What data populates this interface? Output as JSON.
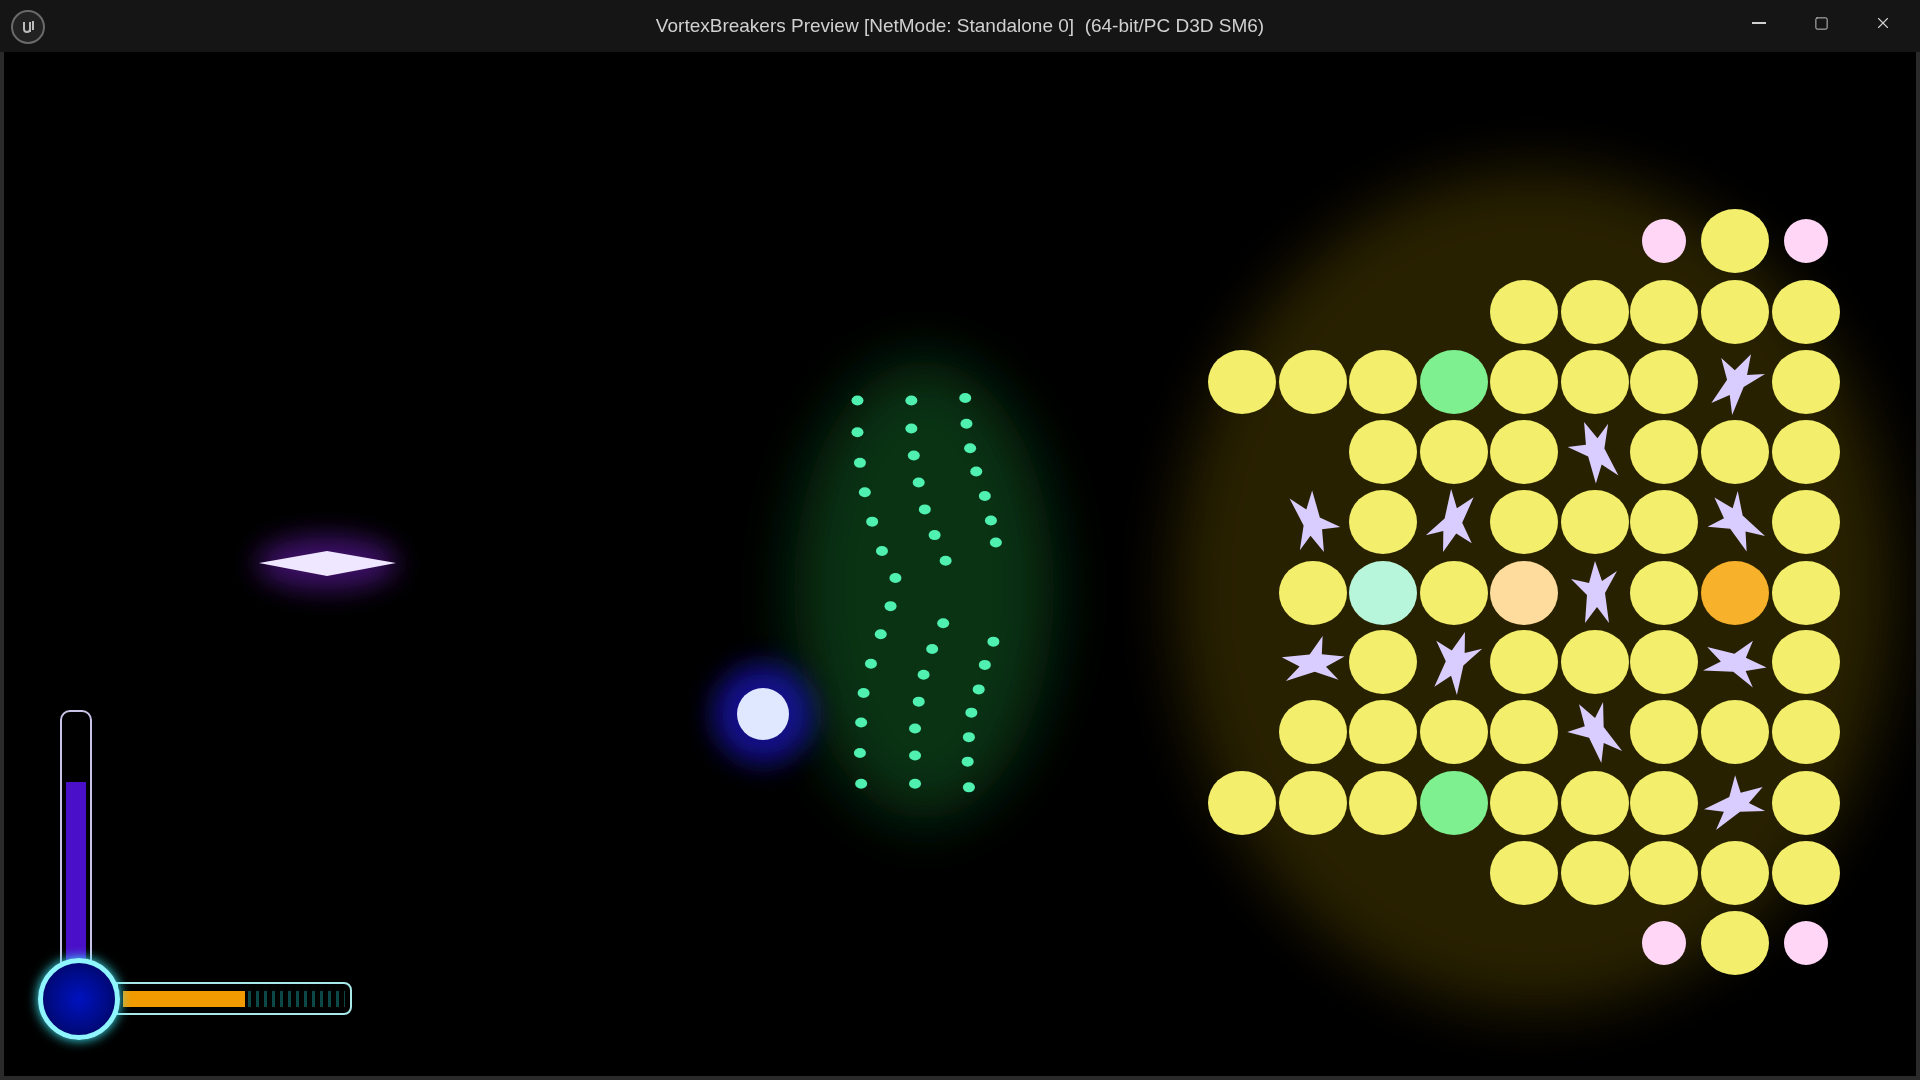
{
  "window": {
    "title": "VortexBreakers Preview [NetMode: Standalone 0]  (64-bit/PC D3D SM6)",
    "controls": [
      {
        "kind": "minimize"
      },
      {
        "kind": "maximize"
      },
      {
        "kind": "close"
      }
    ]
  },
  "hud": {
    "power_meter": {
      "level": 0.73
    },
    "charge_meter": {
      "level": 0.55
    }
  }
}
